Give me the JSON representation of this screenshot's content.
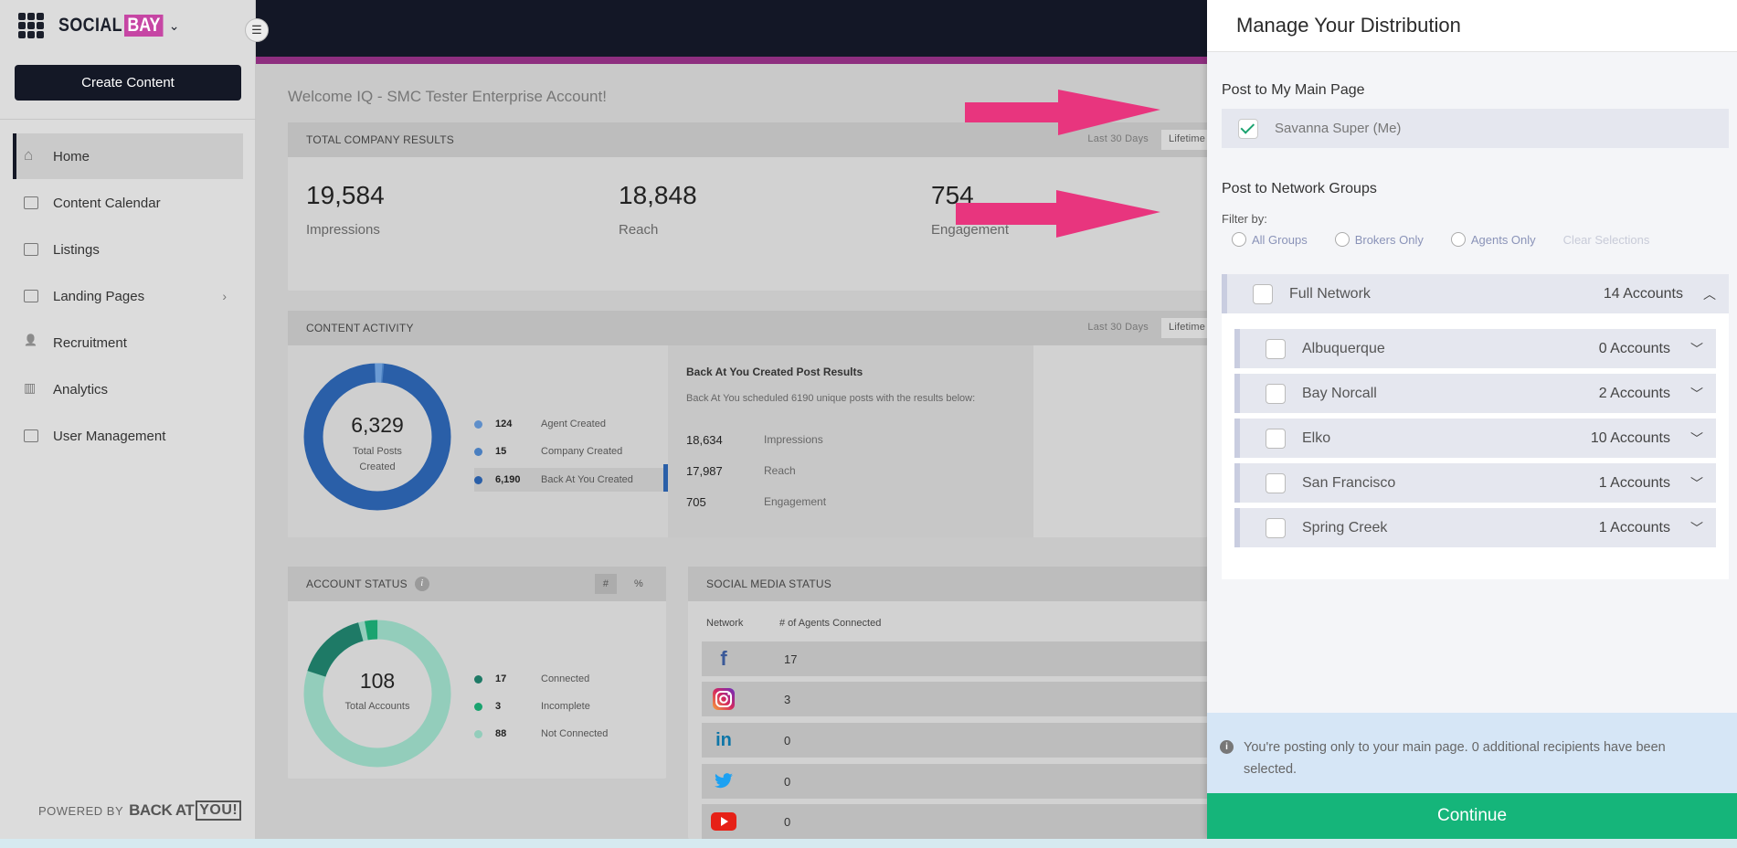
{
  "brand": {
    "name_part1": "SOCIAL",
    "name_part2": "BAY"
  },
  "sidebar": {
    "create_label": "Create Content",
    "items": [
      {
        "label": "Home",
        "icon": "home-icon",
        "active": true
      },
      {
        "label": "Content Calendar",
        "icon": "calendar-icon"
      },
      {
        "label": "Listings",
        "icon": "list-icon"
      },
      {
        "label": "Landing Pages",
        "icon": "page-icon",
        "has_arrow": true
      },
      {
        "label": "Recruitment",
        "icon": "add-person-icon"
      },
      {
        "label": "Analytics",
        "icon": "bar-chart-icon"
      },
      {
        "label": "User Management",
        "icon": "users-icon"
      }
    ],
    "powered_by": "POWERED BY",
    "powered_brand": "BACK AT",
    "powered_you": "YOU!"
  },
  "main": {
    "welcome": "Welcome IQ - SMC Tester Enterprise Account!",
    "company_results": {
      "title": "TOTAL COMPANY RESULTS",
      "range": "Last 30 Days",
      "range_btn": "Lifetime",
      "stats": [
        {
          "value": "19,584",
          "label": "Impressions"
        },
        {
          "value": "18,848",
          "label": "Reach"
        },
        {
          "value": "754",
          "label": "Engagement"
        }
      ]
    },
    "content_activity": {
      "title": "CONTENT ACTIVITY",
      "range": "Last 30 Days",
      "range_btn": "Lifetime",
      "total": "6,329",
      "total_label_1": "Total Posts",
      "total_label_2": "Created",
      "legend": [
        {
          "value": "124",
          "label": "Agent Created",
          "color": "#5f8fca"
        },
        {
          "value": "15",
          "label": "Company Created",
          "color": "#4a7fc0"
        },
        {
          "value": "6,190",
          "label": "Back At You Created",
          "color": "#2a5fa8"
        }
      ],
      "bay_title": "Back At You Created Post Results",
      "bay_desc": "Back At You scheduled 6190 unique posts with the results below:",
      "bay_rows": [
        {
          "value": "18,634",
          "label": "Impressions"
        },
        {
          "value": "17,987",
          "label": "Reach"
        },
        {
          "value": "705",
          "label": "Engagement"
        }
      ]
    },
    "account_status": {
      "title": "ACCOUNT STATUS",
      "toggle_hash": "#",
      "toggle_pct": "%",
      "total": "108",
      "total_label": "Total Accounts",
      "legend": [
        {
          "value": "17",
          "label": "Connected",
          "color": "#1e7a66"
        },
        {
          "value": "3",
          "label": "Incomplete",
          "color": "#1aa36f"
        },
        {
          "value": "88",
          "label": "Not Connected",
          "color": "#93cdbb"
        }
      ]
    },
    "social_media": {
      "title": "SOCIAL MEDIA STATUS",
      "col_network": "Network",
      "col_agents": "# of Agents Connected",
      "rows": [
        {
          "network": "facebook-icon",
          "value": "17"
        },
        {
          "network": "instagram-icon",
          "value": "3"
        },
        {
          "network": "linkedin-icon",
          "value": "0"
        },
        {
          "network": "twitter-icon",
          "value": "0"
        },
        {
          "network": "youtube-icon",
          "value": "0"
        }
      ]
    }
  },
  "panel": {
    "title": "Manage Your Distribution",
    "main_page_title": "Post to My Main Page",
    "main_page_user": "Savanna Super (Me)",
    "network_title": "Post to Network Groups",
    "filter_label": "Filter by:",
    "filters": [
      "All Groups",
      "Brokers Only",
      "Agents Only"
    ],
    "clear": "Clear Selections",
    "full_network": {
      "name": "Full Network",
      "count": "14 Accounts"
    },
    "groups": [
      {
        "name": "Albuquerque",
        "count": "0 Accounts"
      },
      {
        "name": "Bay Norcall",
        "count": "2 Accounts"
      },
      {
        "name": "Elko",
        "count": "10 Accounts"
      },
      {
        "name": "San Francisco",
        "count": "1 Accounts"
      },
      {
        "name": "Spring Creek",
        "count": "1 Accounts"
      }
    ],
    "notice": "You're posting only to your main page. 0 additional recipients have been selected.",
    "continue_label": "Continue"
  },
  "colors": {
    "accent_pink": "#e8357e",
    "continue_green": "#15b57a",
    "donut_blue": "#2a5fa8"
  }
}
